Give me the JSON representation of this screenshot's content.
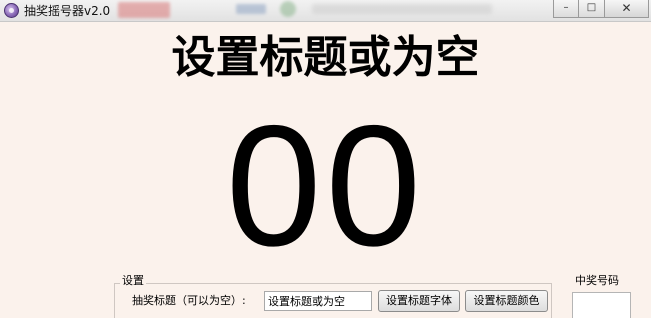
{
  "window": {
    "title": "抽奖摇号器v2.0",
    "controls": {
      "minimize": "–",
      "maximize": "□",
      "close": "✕"
    }
  },
  "display": {
    "title": "设置标题或为空",
    "number": "00"
  },
  "settings": {
    "legend": "设置",
    "title_label": "抽奖标题（可以为空）:",
    "title_value": "设置标题或为空",
    "font_button": "设置标题字体",
    "color_button": "设置标题颜色"
  },
  "winner": {
    "label": "中奖号码",
    "value": ""
  },
  "colors": {
    "background": "#fbf2ec",
    "text": "#000000"
  },
  "icons": {
    "app": "app-icon"
  }
}
